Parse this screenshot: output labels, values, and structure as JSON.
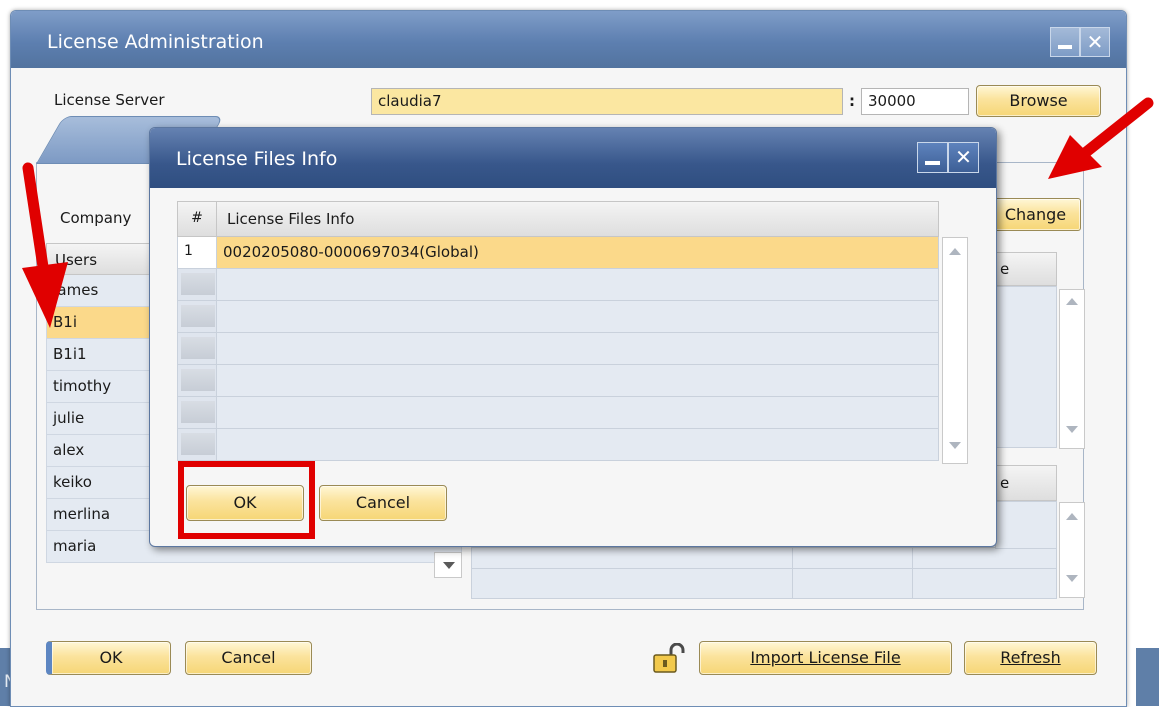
{
  "main_window": {
    "title": "License Administration",
    "license_server_label": "License Server",
    "license_server_value": "claudia7",
    "port_separator": ":",
    "port_value": "30000",
    "browse_label": "Browse",
    "company_label": "Company",
    "change_label": "Change",
    "users_header": "Users",
    "users": [
      "James",
      "B1i",
      "B1i1",
      "timothy",
      "julie",
      "alex",
      "keiko",
      "merlina",
      "maria"
    ],
    "selected_user": "B1i",
    "right_header_fragment_1": "e",
    "right_header_fragment_2": "e",
    "ok_label": "OK",
    "cancel_label": "Cancel",
    "import_label": "Import License File",
    "refresh_label": "Refresh"
  },
  "dialog": {
    "title": "License Files Info",
    "col_number": "#",
    "col_info": "License Files Info",
    "rows": [
      {
        "num": "1",
        "info": "0020205080-0000697034(Global)"
      },
      {
        "num": "",
        "info": ""
      },
      {
        "num": "",
        "info": ""
      },
      {
        "num": "",
        "info": ""
      },
      {
        "num": "",
        "info": ""
      },
      {
        "num": "",
        "info": ""
      },
      {
        "num": "",
        "info": ""
      }
    ],
    "ok_label": "OK",
    "cancel_label": "Cancel"
  },
  "background": {
    "edge_letter": "N"
  },
  "colors": {
    "accent_yellow": "#fbe39c",
    "selection": "#fbd98a",
    "titlebar_blue": "#5d7fb0",
    "highlight_red": "#e00000"
  },
  "icons": {
    "minimize": "minimize-icon",
    "close": "close-icon",
    "lock": "padlock-icon"
  }
}
